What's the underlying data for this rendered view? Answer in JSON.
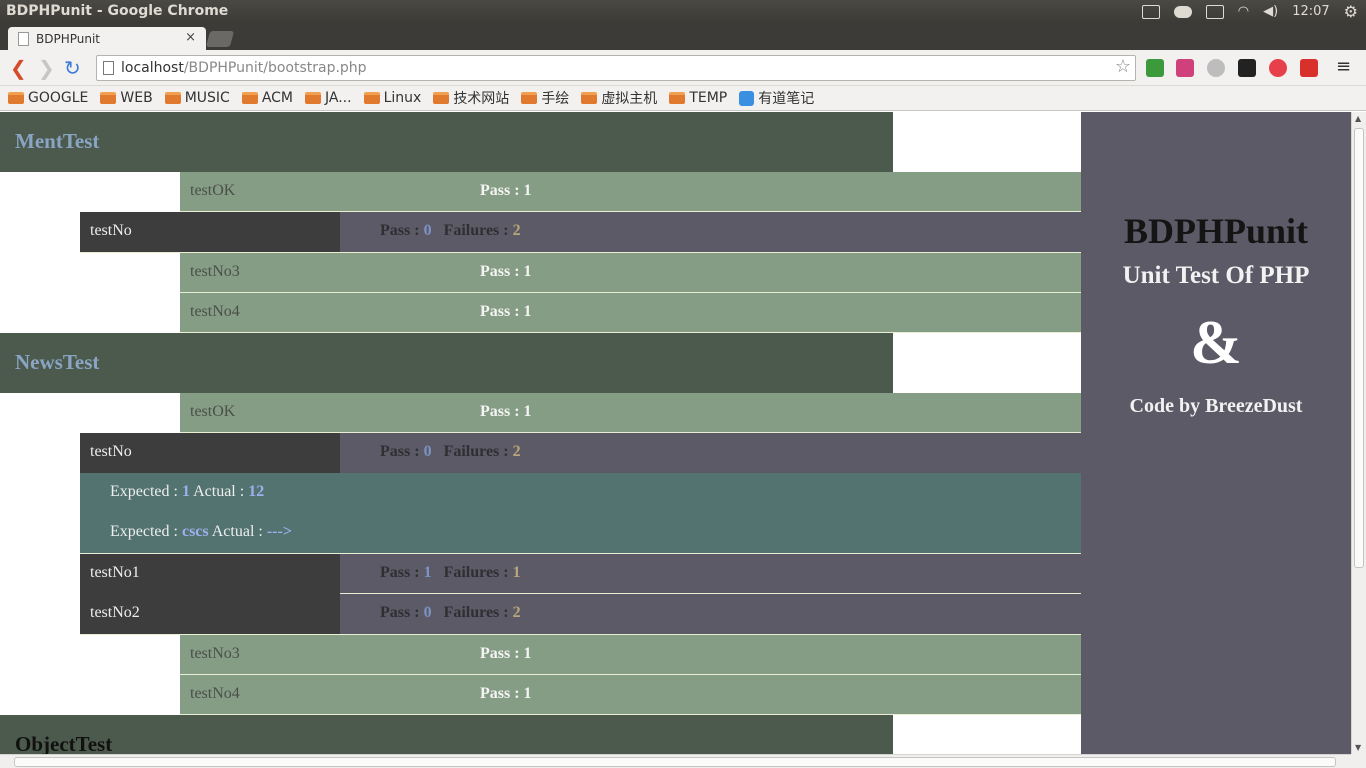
{
  "os": {
    "window_title": "BDPHPunit - Google Chrome",
    "clock": "12:07"
  },
  "tab": {
    "title": "BDPHPunit",
    "close": "×"
  },
  "toolbar": {
    "back_icon": "❮",
    "forward_icon": "❯",
    "reload_icon": "↻",
    "url_host": "localhost",
    "url_path": "/BDPHPunit/bootstrap.php",
    "star_icon": "☆",
    "menu_icon": "≡"
  },
  "bookmarks": [
    "GOOGLE",
    "WEB",
    "MUSIC",
    "ACM",
    "JA...",
    "Linux",
    "技术网站",
    "手绘",
    "虚拟主机",
    "TEMP"
  ],
  "bookmark_note": "有道笔记",
  "suites": [
    {
      "name": "MentTest"
    },
    {
      "name": "NewsTest"
    },
    {
      "name": "ObjectTest"
    }
  ],
  "rows": {
    "s1_testOK": {
      "name": "testOK",
      "stat": "Pass : 1"
    },
    "s1_testNo": {
      "name": "testNo",
      "pass_label": "Pass : ",
      "pass": "0",
      "fail_label": "Failures : ",
      "fail": "2"
    },
    "s1_testNo3": {
      "name": "testNo3",
      "stat": "Pass : 1"
    },
    "s1_testNo4": {
      "name": "testNo4",
      "stat": "Pass : 1"
    },
    "s2_testOK": {
      "name": "testOK",
      "stat": "Pass : 1"
    },
    "s2_testNo": {
      "name": "testNo",
      "pass_label": "Pass : ",
      "pass": "0",
      "fail_label": "Failures : ",
      "fail": "2"
    },
    "s2_detail1": {
      "exp_label": "Expected : ",
      "exp": "1",
      "act_label": " Actual : ",
      "act": "12"
    },
    "s2_detail2": {
      "exp_label": "Expected : ",
      "exp": "cscs",
      "act_label": " Actual : ",
      "act": "--->"
    },
    "s2_testNo1": {
      "name": "testNo1",
      "pass_label": "Pass : ",
      "pass": "1",
      "fail_label": "Failures : ",
      "fail": "1"
    },
    "s2_testNo2": {
      "name": "testNo2",
      "pass_label": "Pass : ",
      "pass": "0",
      "fail_label": "Failures : ",
      "fail": "2"
    },
    "s2_testNo3": {
      "name": "testNo3",
      "stat": "Pass : 1"
    },
    "s2_testNo4": {
      "name": "testNo4",
      "stat": "Pass : 1"
    }
  },
  "sidebar": {
    "title": "BDPHPunit",
    "subtitle": "Unit Test Of PHP",
    "amp": "&",
    "credit": "Code by BreezeDust"
  },
  "colors": {
    "suite_bg": "#4b5a4c",
    "pass_row_bg": "#869d85",
    "fail_row_bg": "#5b5a66",
    "detail_bg": "#52736f",
    "accent_blue": "#9fb0ee"
  }
}
